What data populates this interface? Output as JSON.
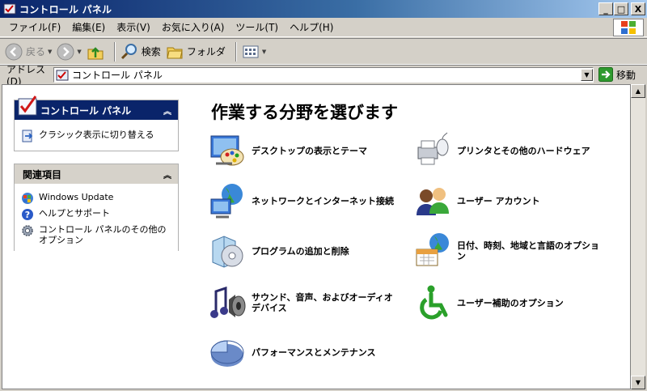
{
  "window": {
    "title": "コントロール パネル",
    "buttons": [
      "_",
      "□",
      "X"
    ]
  },
  "menu": {
    "items": [
      "ファイル(F)",
      "編集(E)",
      "表示(V)",
      "お気に入り(A)",
      "ツール(T)",
      "ヘルプ(H)"
    ]
  },
  "toolbar": {
    "back_label": "戻る",
    "search_label": "検索",
    "folders_label": "フォルダ"
  },
  "address": {
    "label": "アドレス(D)",
    "value": "コントロール パネル",
    "go_label": "移動"
  },
  "sidebar": {
    "control_panel": {
      "title": "コントロール パネル",
      "switch_label": "クラシック表示に切り替える"
    },
    "related": {
      "title": "関連項目",
      "links": [
        "Windows Update",
        "ヘルプとサポート",
        "コントロール パネルのその他のオプション"
      ]
    }
  },
  "main": {
    "heading": "作業する分野を選びます",
    "categories": [
      "デスクトップの表示とテーマ",
      "プリンタとその他のハードウェア",
      "ネットワークとインターネット接続",
      "ユーザー アカウント",
      "プログラムの追加と削除",
      "日付、時刻、地域と言語のオプション",
      "サウンド、音声、およびオーディオ デバイス",
      "ユーザー補助のオプション",
      "パフォーマンスとメンテナンス"
    ]
  }
}
